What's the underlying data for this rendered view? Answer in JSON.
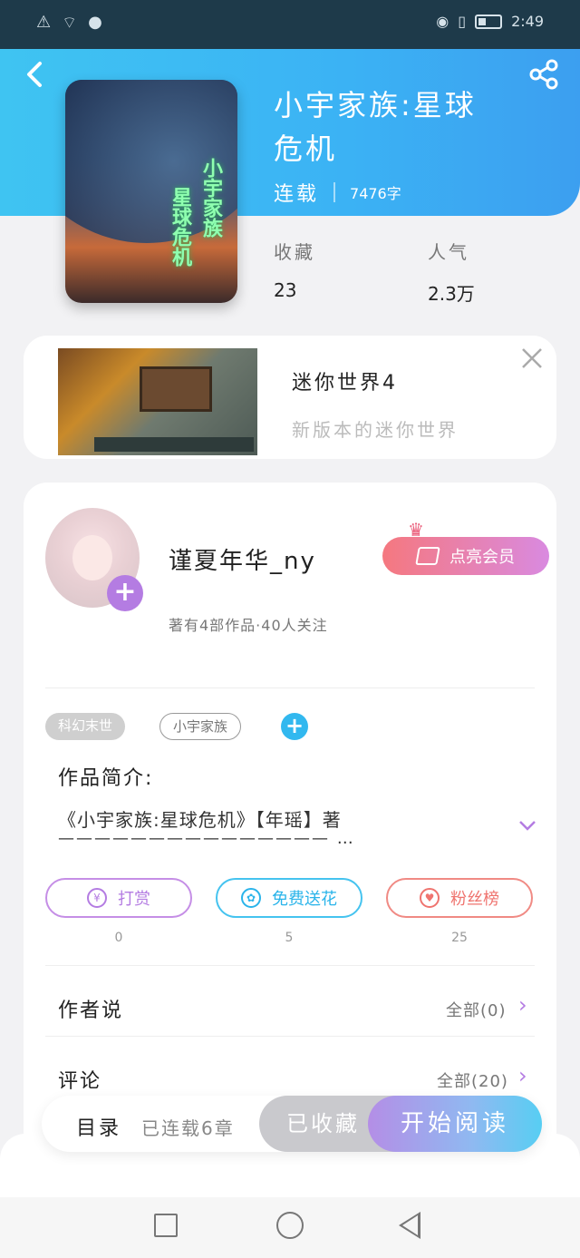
{
  "status_bar": {
    "time": "2:49",
    "icons_left": [
      "alert-icon",
      "wifi-icon",
      "qq-icon"
    ],
    "icons_right": [
      "eye-icon",
      "vibrate-icon",
      "battery-icon"
    ]
  },
  "book": {
    "title_line1": "小宇家族:星球",
    "title_line2": "危机",
    "status": "连载",
    "word_count": "7476字",
    "cover_text_1": "小宇家族",
    "cover_text_2": "星球危机",
    "stats": {
      "favorites_label": "收藏",
      "favorites_value": "23",
      "popularity_label": "人气",
      "popularity_value": "2.3万"
    }
  },
  "ad": {
    "title": "迷你世界4",
    "subtitle": "新版本的迷你世界"
  },
  "author": {
    "name": "谨夏年华_ny",
    "meta": "著有4部作品·40人关注",
    "vip_label": "点亮会员"
  },
  "tags": [
    "科幻末世",
    "小宇家族"
  ],
  "intro": {
    "label": "作品简介:",
    "text": "《小宇家族:星球危机》【年瑶】著",
    "dashes": "——————————————— …"
  },
  "actions": [
    {
      "label": "打赏",
      "count": "0"
    },
    {
      "label": "免费送花",
      "count": "5"
    },
    {
      "label": "粉丝榜",
      "count": "25"
    }
  ],
  "rows": {
    "author_say": {
      "title": "作者说",
      "all": "全部(0)"
    },
    "comments": {
      "title": "评论",
      "all": "全部(20)"
    }
  },
  "bottom": {
    "catalog": "目录",
    "chapters": "已连载6章",
    "collected": "已收藏",
    "read": "开始阅读"
  },
  "colors": {
    "header": "#3bb2f4",
    "accent_purple": "#b47ce2",
    "accent_blue": "#32b8ef",
    "accent_red": "#ef746f"
  }
}
